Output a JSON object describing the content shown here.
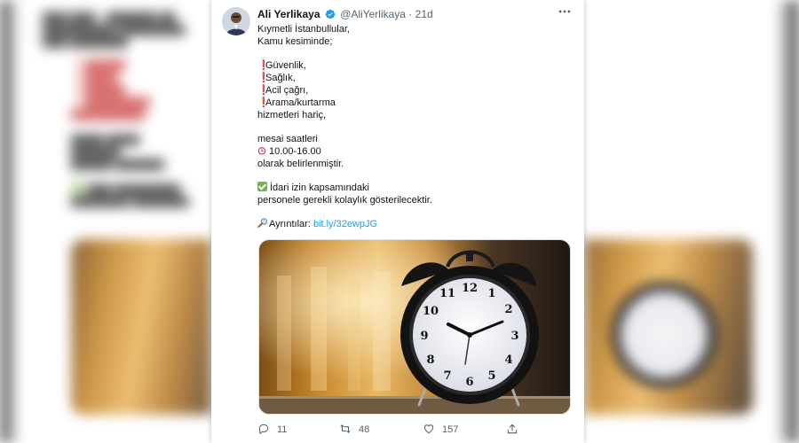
{
  "tweet": {
    "author": {
      "name": "Ali Yerlikaya",
      "handle": "@AliYerlikaya",
      "separator": "·",
      "time": "21d",
      "verified": true,
      "avatar_icon": "user-avatar"
    },
    "more_icon": "ellipsis-icon",
    "lines": {
      "l1": "Kıymetli İstanbullular,",
      "l2": "Kamu kesiminde;",
      "l3": "Güvenlik,",
      "l4": "Sağlık,",
      "l5": "Acil çağrı,",
      "l6": "Arama/kurtarma",
      "l7": "hizmetleri hariç,",
      "l8": "mesai saatleri",
      "l9": "10.00-16.00",
      "l10": "olarak belirlenmiştir.",
      "l11": "İdari izin kapsamındaki",
      "l12": "personele gerekli kolaylık gösterilecektir.",
      "l13_prefix": "Ayrıntılar:",
      "l13_link": "bit.ly/32ewpJG"
    },
    "emoji": {
      "exclamation": "❗",
      "alarm": "alarm-clock-icon",
      "check": "check-mark-icon",
      "magnifier": "magnifying-glass-icon"
    },
    "media": {
      "description_icon": "alarm-clock-photo",
      "clock_numbers": [
        "12",
        "1",
        "2",
        "3",
        "4",
        "5",
        "6",
        "7",
        "8",
        "9",
        "10",
        "11"
      ]
    },
    "stats": {
      "replies": "11",
      "retweets": "48",
      "likes": "157"
    },
    "colors": {
      "link": "#1d9bf0",
      "verified": "#1d9bf0",
      "text": "#0f1419",
      "muted": "#536471"
    }
  }
}
